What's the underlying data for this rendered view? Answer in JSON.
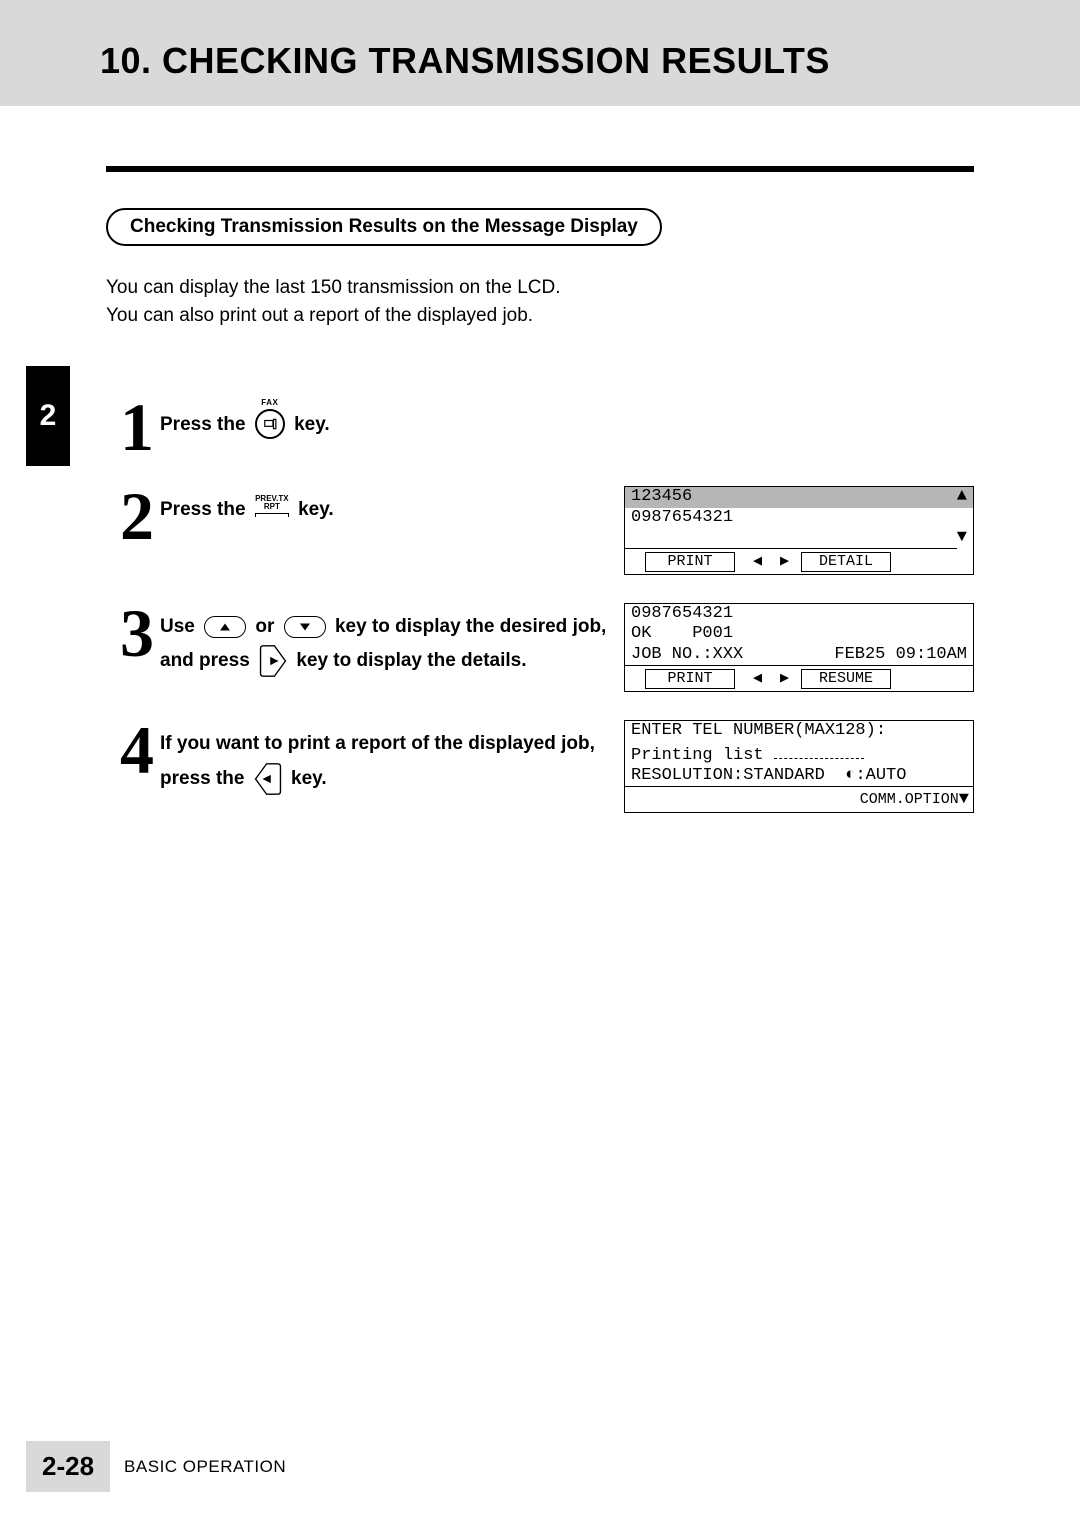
{
  "header": {
    "title": "10. CHECKING TRANSMISSION RESULTS"
  },
  "side_tab": "2",
  "pill_title": "Checking Transmission Results on the Message Display",
  "intro_line1": "You can display the last 150 transmission on the LCD.",
  "intro_line2": "You can also print out a report of the displayed job.",
  "steps": {
    "s1": {
      "num": "1",
      "t_press_the": "Press the",
      "t_key": "key.",
      "faxkey": {
        "label": "FAX"
      }
    },
    "s2": {
      "num": "2",
      "t_press_the": "Press the",
      "t_key": "key.",
      "prevtx": {
        "line1": "PREV.TX",
        "line2": "RPT"
      },
      "lcd": {
        "line1": "123456",
        "line2": "0987654321",
        "soft_left": "PRINT",
        "soft_right": "DETAIL"
      }
    },
    "s3": {
      "num": "3",
      "t_use": "Use",
      "t_or": "or",
      "t_tail1": "key to display the desired job,",
      "t_and_press": "and press",
      "t_tail2": "key to display the details.",
      "lcd": {
        "line1": "0987654321",
        "line2": "OK    P001",
        "line3_left": "JOB NO.:XXX",
        "line3_right": "FEB25 09:10AM",
        "soft_left": "PRINT",
        "soft_right": "RESUME"
      }
    },
    "s4": {
      "num": "4",
      "t_line1": "If you want to print a report of the displayed job,",
      "t_press_the": "press the",
      "t_key": "key.",
      "lcd": {
        "line1": "ENTER TEL NUMBER(MAX128):",
        "line2_text": "Printing list",
        "line3_left": "RESOLUTION:STANDARD",
        "line3_right": ":AUTO",
        "soft_right": "COMM.OPTION"
      }
    }
  },
  "footer": {
    "page": "2-28",
    "section": "BASIC OPERATION"
  }
}
